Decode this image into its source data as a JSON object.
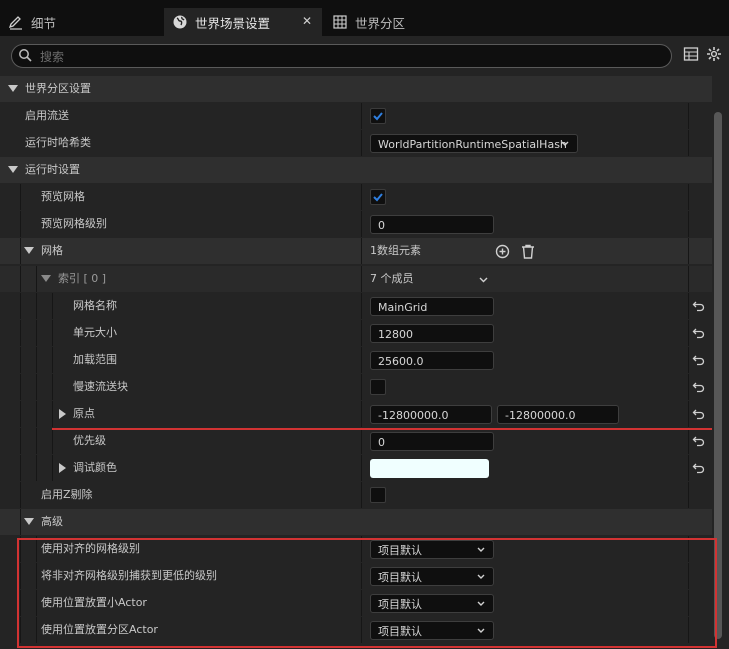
{
  "tabs": [
    {
      "label": "细节",
      "icon": "pencil-icon",
      "active": false
    },
    {
      "label": "世界场景设置",
      "icon": "globe-icon",
      "active": true
    },
    {
      "label": "世界分区",
      "icon": "grid-icon",
      "active": false
    }
  ],
  "search": {
    "placeholder": "搜索"
  },
  "toolbar": {
    "table_icon": "table-icon",
    "settings_icon": "gear-icon"
  },
  "sections": {
    "world_partition": {
      "label": "世界分区设置"
    },
    "runtime": {
      "label": "运行时设置"
    },
    "advanced": {
      "label": "高级"
    }
  },
  "rows": {
    "enable_streaming": {
      "label": "启用流送",
      "checked": true
    },
    "runtime_hash_class": {
      "label": "运行时哈希类",
      "value": "WorldPartitionRuntimeSpatialHash"
    },
    "preview_grid": {
      "label": "预览网格",
      "checked": true
    },
    "preview_grid_level": {
      "label": "预览网格级别",
      "value": "0"
    },
    "grids": {
      "label": "网格",
      "value": "1数组元素"
    },
    "index0": {
      "label": "索引 [ 0 ]",
      "value": "7 个成员"
    },
    "grid_name": {
      "label": "网格名称",
      "value": "MainGrid"
    },
    "cell_size": {
      "label": "单元大小",
      "value": "12800"
    },
    "loading_range": {
      "label": "加载范围",
      "value": "25600.0"
    },
    "slow_streaming": {
      "label": "慢速流送块",
      "checked": false
    },
    "origin": {
      "label": "原点",
      "x": "-12800000.0",
      "y": "-12800000.0"
    },
    "priority": {
      "label": "优先级",
      "value": "0"
    },
    "debug_color": {
      "label": "调试颜色",
      "color": "#f0ffff"
    },
    "enable_z_culling": {
      "label": "启用Z剔除",
      "checked": false
    },
    "use_aligned_grid_levels": {
      "label": "使用对齐的网格级别",
      "value": "项目默认"
    },
    "snap_non_aligned": {
      "label": "将非对齐网格级别捕获到更低的级别",
      "value": "项目默认"
    },
    "place_small_actors": {
      "label": "使用位置放置小Actor",
      "value": "项目默认"
    },
    "place_partitioned_actors": {
      "label": "使用位置放置分区Actor",
      "value": "项目默认"
    }
  },
  "colors": {
    "highlight": "#d23333",
    "accent": "#2f7fe0"
  }
}
